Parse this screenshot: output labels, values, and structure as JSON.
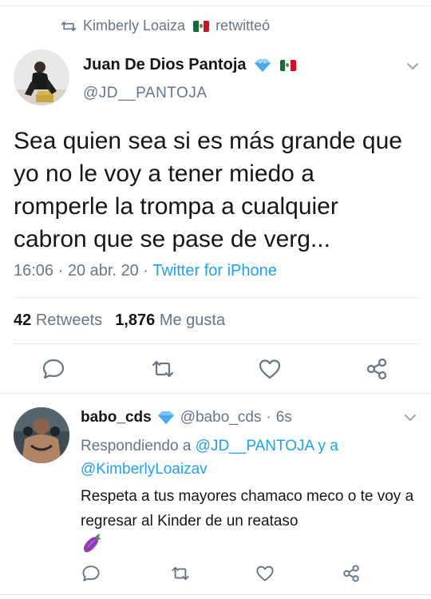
{
  "retweet_context": {
    "user": "Kimberly Loaiza",
    "action": "retwitteó"
  },
  "tweet": {
    "display_name": "Juan De Dios Pantoja",
    "handle": "@JD__PANTOJA",
    "text": "Sea quien sea si es más grande que yo no le voy a tener miedo a romperle la trompa a cualquier cabron que se pase de verg...",
    "time": "16:06",
    "date": "20 abr. 20",
    "source": "Twitter for iPhone",
    "retweets_count": "42",
    "retweets_label": "Retweets",
    "likes_count": "1,876",
    "likes_label": "Me gusta"
  },
  "reply": {
    "display_name": "babo_cds",
    "handle": "@babo_cds",
    "time_ago": "6s",
    "replying_prefix": "Respondiendo a",
    "mention_1": "@JD__PANTOJA",
    "replying_joiner": "y a",
    "mention_2": "@KimberlyLoaizav",
    "text": "Respeta a tus mayores chamaco meco o te voy a regresar al Kinder de un reataso"
  },
  "icons": {
    "retweet_context": "retweet-icon",
    "verified": "diamond-emoji-icon",
    "flag": "mexico-flag-icon",
    "menu": "chevron-down-icon",
    "reply": "reply-icon",
    "retweet": "retweet-icon",
    "like": "heart-icon",
    "share": "share-icon",
    "emoji": "eggplant-emoji-icon"
  },
  "colors": {
    "accent": "#1da1f2",
    "secondary_text": "#657786",
    "primary_text": "#14171a",
    "divider": "#e1e8ed"
  }
}
